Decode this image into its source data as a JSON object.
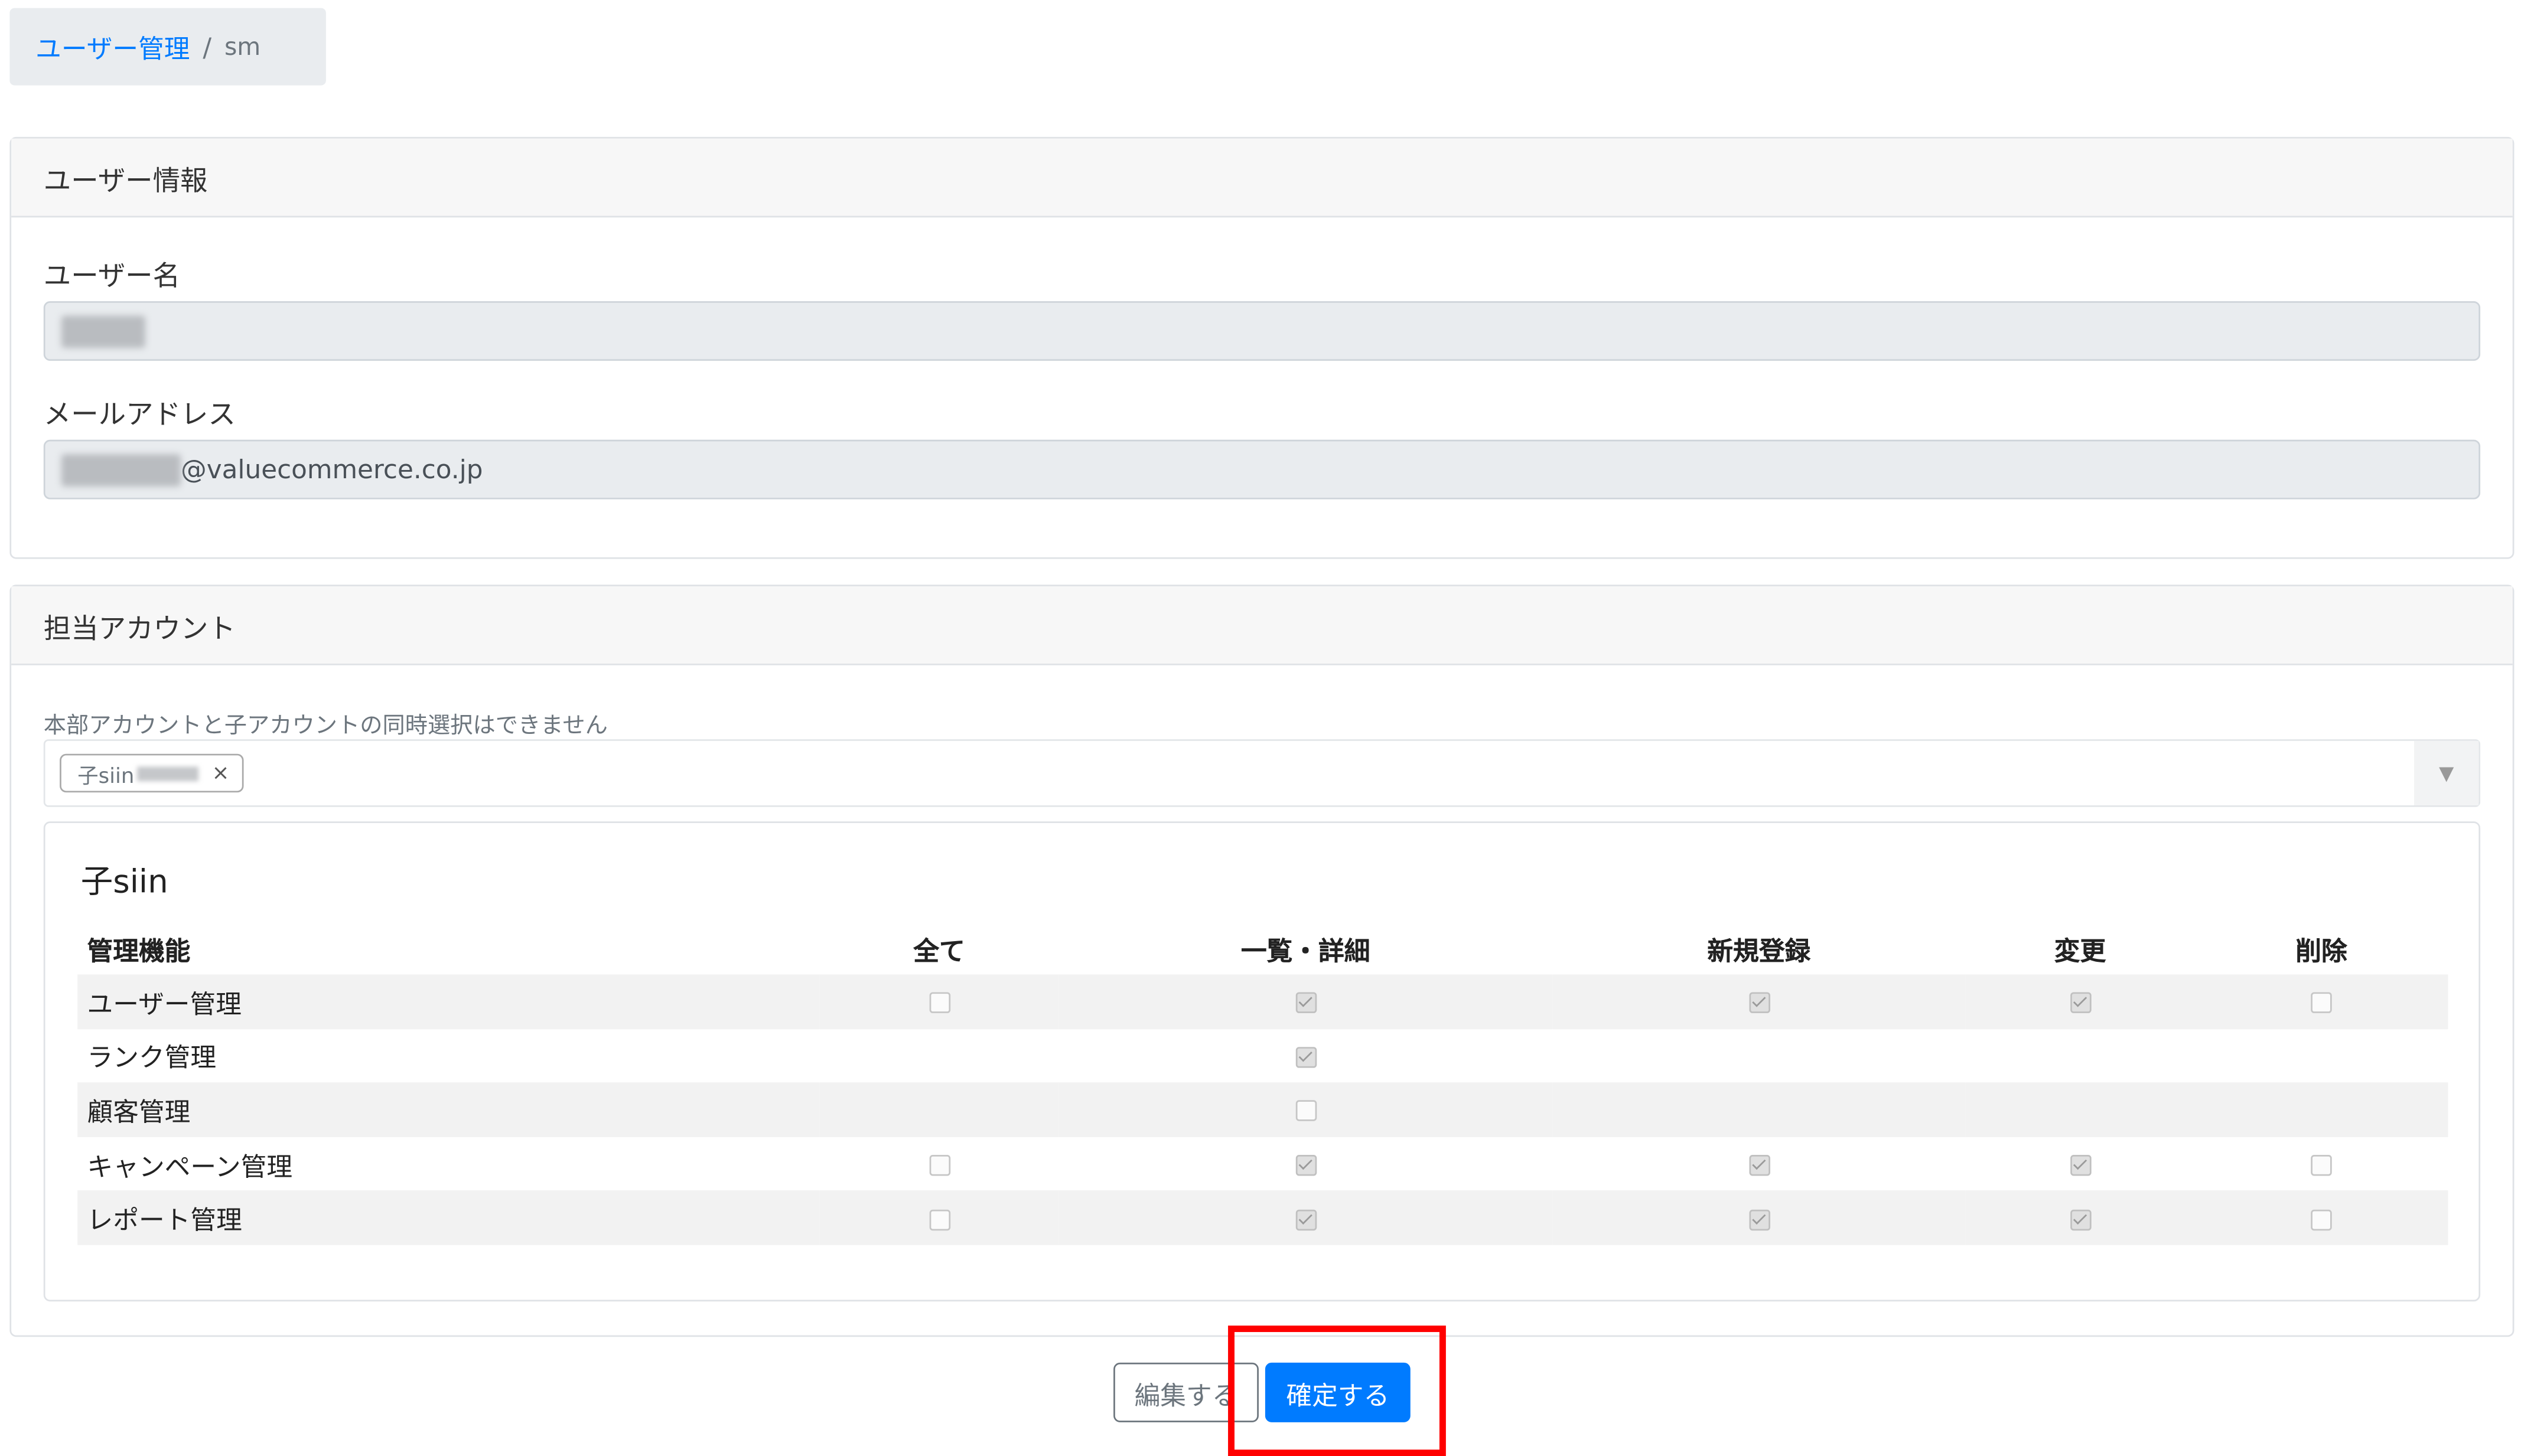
{
  "breadcrumb": {
    "link": "ユーザー管理",
    "separator": "/",
    "current": "sm"
  },
  "user_info": {
    "header": "ユーザー情報",
    "username_label": "ユーザー名",
    "email_label": "メールアドレス",
    "email_suffix": "@valuecommerce.co.jp"
  },
  "accounts": {
    "header": "担当アカウント",
    "hint": "本部アカウントと子アカウントの同時選択はできません",
    "selected_tag": "子siin",
    "tag_remove": "×",
    "dropdown_arrow": "▼",
    "account_name": "子siin"
  },
  "permissions": {
    "columns": [
      "管理機能",
      "全て",
      "一覧・詳細",
      "新規登録",
      "変更",
      "削除"
    ],
    "rows": [
      {
        "name": "ユーザー管理",
        "cells": [
          "unchecked",
          "checked",
          "checked",
          "checked",
          "unchecked"
        ]
      },
      {
        "name": "ランク管理",
        "cells": [
          "none",
          "checked",
          "none",
          "none",
          "none"
        ]
      },
      {
        "name": "顧客管理",
        "cells": [
          "none",
          "unchecked",
          "none",
          "none",
          "none"
        ]
      },
      {
        "name": "キャンペーン管理",
        "cells": [
          "unchecked",
          "checked",
          "checked",
          "checked",
          "unchecked"
        ]
      },
      {
        "name": "レポート管理",
        "cells": [
          "unchecked",
          "checked",
          "checked",
          "checked",
          "unchecked"
        ]
      }
    ]
  },
  "actions": {
    "edit_label": "編集する",
    "confirm_label": "確定する"
  },
  "colors": {
    "primary": "#007bff",
    "highlight": "#ff0000"
  }
}
